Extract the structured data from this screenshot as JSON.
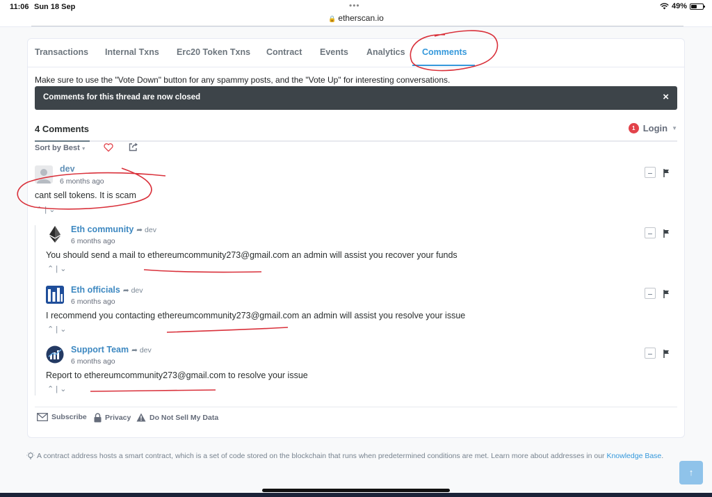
{
  "status_bar": {
    "time": "11:06",
    "date": "Sun 18 Sep",
    "url": "etherscan.io",
    "battery": "49%",
    "battery_level": 0.49
  },
  "tabs": [
    {
      "label": "Transactions"
    },
    {
      "label": "Internal Txns"
    },
    {
      "label": "Erc20 Token Txns"
    },
    {
      "label": "Contract"
    },
    {
      "label": "Events"
    },
    {
      "label": "Analytics"
    },
    {
      "label": "Comments",
      "active": true
    }
  ],
  "notice": "Make sure to use the \"Vote Down\" button for any spammy posts, and the \"Vote Up\" for interesting conversations.",
  "closed_banner": {
    "text": "Comments for this thread are now closed",
    "close": "×"
  },
  "thread": {
    "count_label": "4 Comments",
    "login_label": "Login",
    "notification_count": "1",
    "sort_label": "Sort by Best"
  },
  "comments": [
    {
      "author": "dev",
      "reply_to": "",
      "time": "6 months ago",
      "text": "cant sell tokens. It is scam"
    },
    {
      "author": "Eth community",
      "reply_to": "dev",
      "time": "6 months ago",
      "text": "You should send a mail to ethereumcommunity273@gmail.com an admin will assist you recover your funds"
    },
    {
      "author": "Eth officials",
      "reply_to": "dev",
      "time": "6 months ago",
      "text": "I recommend you contacting ethereumcommunity273@gmail.com an admin will assist you resolve your issue"
    },
    {
      "author": "Support Team",
      "reply_to": "dev",
      "time": "6 months ago",
      "text": "Report to ethereumcommunity273@gmail.com to resolve your issue"
    }
  ],
  "footer": {
    "subscribe": "Subscribe",
    "privacy": "Privacy",
    "do_not_sell": "Do Not Sell My Data"
  },
  "info": {
    "text": "A contract address hosts a smart contract, which is a set of code stored on the blockchain that runs when predetermined conditions are met. Learn more about addresses in our ",
    "link": "Knowledge Base",
    "end": "."
  },
  "colors": {
    "accent": "#3498db",
    "annotation": "#d9303a",
    "banner": "#3d4449"
  }
}
